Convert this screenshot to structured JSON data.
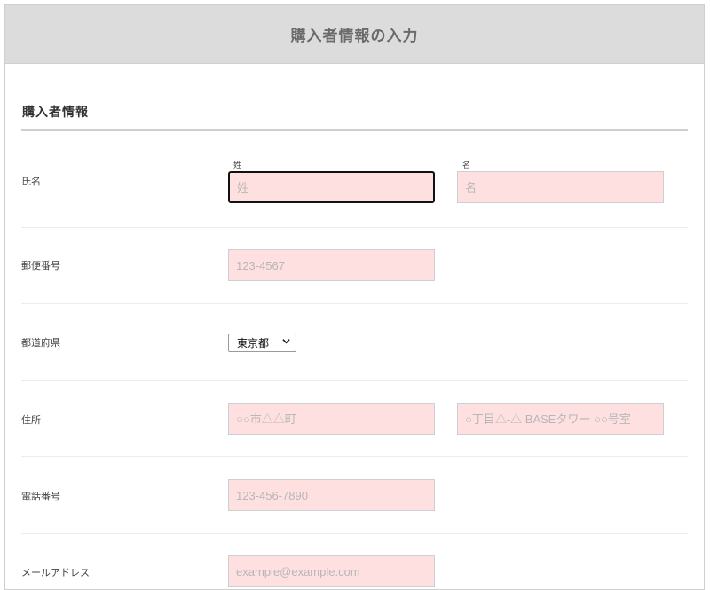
{
  "header": {
    "title": "購入者情報の入力"
  },
  "section": {
    "title": "購入者情報"
  },
  "fields": {
    "name": {
      "label": "氏名",
      "last_sublabel": "姓",
      "last_placeholder": "姓",
      "first_sublabel": "名",
      "first_placeholder": "名"
    },
    "postal": {
      "label": "郵便番号",
      "placeholder": "123-4567"
    },
    "prefecture": {
      "label": "都道府県",
      "value": "東京都"
    },
    "address": {
      "label": "住所",
      "placeholder1": "○○市△△町",
      "placeholder2": "○丁目△-△ BASEタワー ○○号室"
    },
    "phone": {
      "label": "電話番号",
      "placeholder": "123-456-7890"
    },
    "email": {
      "label": "メールアドレス",
      "placeholder": "example@example.com"
    }
  },
  "colors": {
    "header_bg": "#dcdcdc",
    "field_bg": "#ffe0e0",
    "rule": "#cfcfcf"
  },
  "icons": {
    "select": "chevron-down-icon"
  }
}
